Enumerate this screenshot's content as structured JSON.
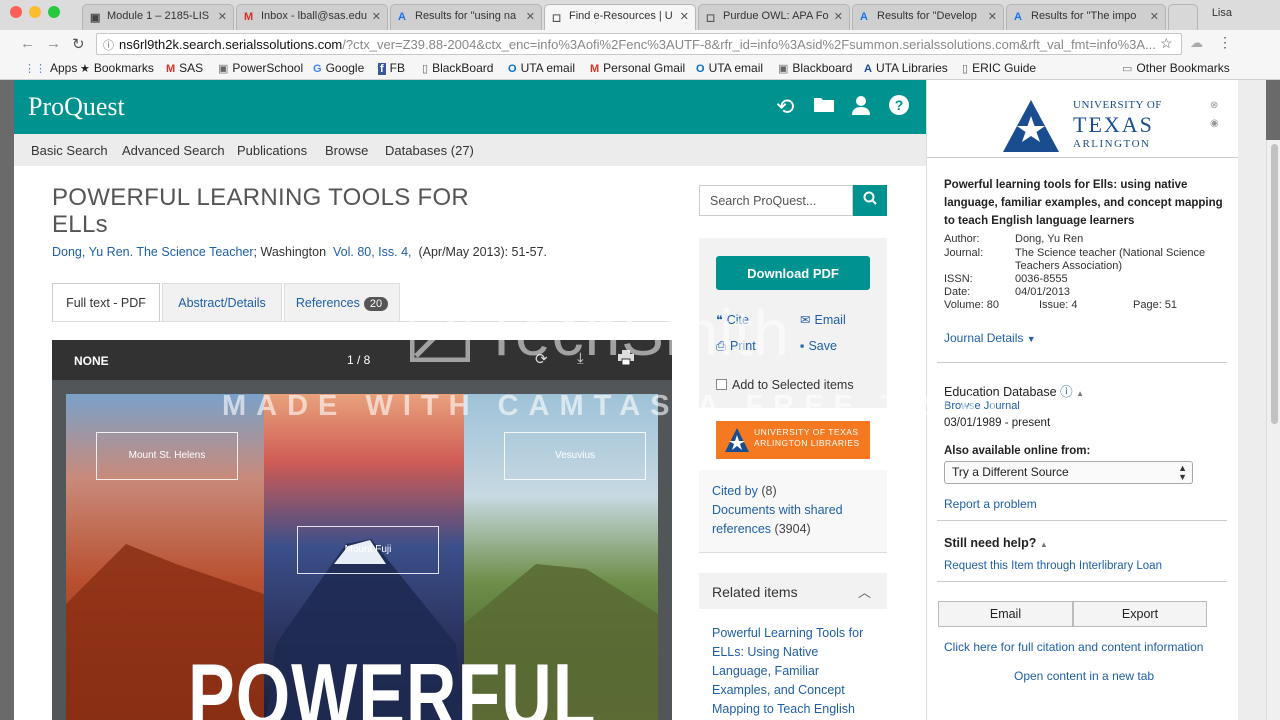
{
  "browser": {
    "tabs": [
      {
        "favicon": "▣",
        "label": "Module 1 – 2185-LIS"
      },
      {
        "favicon": "M",
        "label": "Inbox - lball@sas.edu"
      },
      {
        "favicon": "A",
        "label": "Results for \"using na"
      },
      {
        "favicon": "◻",
        "label": "Find e-Resources | U"
      },
      {
        "favicon": "◻",
        "label": "Purdue OWL: APA Fo"
      },
      {
        "favicon": "A",
        "label": "Results for \"Develop"
      },
      {
        "favicon": "A",
        "label": "Results for \"The impo"
      }
    ],
    "profile": "Lisa",
    "url_host": "ns6rl9th2k.search.serialssolutions.com",
    "url_rest": "/?ctx_ver=Z39.88-2004&ctx_enc=info%3Aofi%2Fenc%3AUTF-8&rfr_id=info%3Asid%2Fsummon.serialssolutions.com&rft_val_fmt=info%3A...",
    "bookmarks": [
      "Apps",
      "Bookmarks",
      "SAS",
      "PowerSchool",
      "Google",
      "FB",
      "BlackBoard",
      "UTA email",
      "Personal Gmail",
      "UTA email",
      "Blackboard",
      "UTA Libraries",
      "ERIC Guide"
    ],
    "other_bookmarks": "Other Bookmarks"
  },
  "proquest": {
    "logo": "ProQuest",
    "nav": [
      "Basic Search",
      "Advanced Search",
      "Publications",
      "Browse",
      "Databases (27)"
    ],
    "title": "POWERFUL LEARNING TOOLS FOR ELLs",
    "author": "Dong, Yu Ren.",
    "journal": "The Science Teacher",
    "place": "; Washington",
    "volume": "Vol. 80, Iss. 4,",
    "date_pages": "(Apr/May 2013): 51-57.",
    "tabs": {
      "full": "Full text - PDF",
      "abstract": "Abstract/Details",
      "refs": "References",
      "refs_count": "20"
    },
    "pdf": {
      "name": "NONE",
      "page": "1 / 8",
      "labels": [
        "Mount St. Helens",
        "Mount Fuji",
        "Vesuvius"
      ],
      "cover_word": "POWERFUL"
    },
    "search_placeholder": "Search ProQuest...",
    "download": "Download PDF",
    "cite": "Cite",
    "email": "Email",
    "print": "Print",
    "save": "Save",
    "add_selected": "Add to Selected items",
    "library_badge": "UNIVERSITY OF TEXAS ARLINGTON LIBRARIES",
    "cited_by": "Cited by",
    "cited_count": "(8)",
    "shared_refs": "Documents with shared references",
    "shared_count": "(3904)",
    "related_head": "Related items",
    "related_item": "Powerful Learning Tools for ELLs: Using Native Language, Familiar Examples, and Concept Mapping to Teach English"
  },
  "sidebar": {
    "uni_small": "UNIVERSITY OF",
    "uni_big": "TEXAS",
    "uni_city": "ARLINGTON",
    "title": "Powerful learning tools for Ells: using native language, familiar examples, and concept mapping to teach English language learners",
    "meta": {
      "author_label": "Author:",
      "author": "Dong, Yu Ren",
      "journal_label": "Journal:",
      "journal": "The Science teacher (National Science Teachers Association)",
      "issn_label": "ISSN:",
      "issn": "0036-8555",
      "date_label": "Date:",
      "date": "04/01/2013",
      "volume_label": "Volume: 80",
      "issue_label": "Issue: 4",
      "page_label": "Page: 51"
    },
    "journal_details": "Journal Details",
    "database": "Education Database",
    "browse_journal": "Browse Journal",
    "coverage": "03/01/1989 - present",
    "also_online": "Also available online from:",
    "source_select": "Try a Different Source",
    "report": "Report a problem",
    "still_help": "Still need help?",
    "ill": "Request this Item through Interlibrary Loan",
    "email_btn": "Email",
    "export_btn": "Export",
    "full_citation": "Click here for full citation and content information",
    "new_tab": "Open content in a new tab"
  },
  "watermark": {
    "brand": "TechSmith",
    "note": "MADE WITH CAMTASIA FREE TRIAL"
  },
  "colors": {
    "proquest_teal": "#00928f",
    "link_blue": "#1f5fa8",
    "uta_blue": "#1a4d8f",
    "uta_orange": "#f47920"
  }
}
